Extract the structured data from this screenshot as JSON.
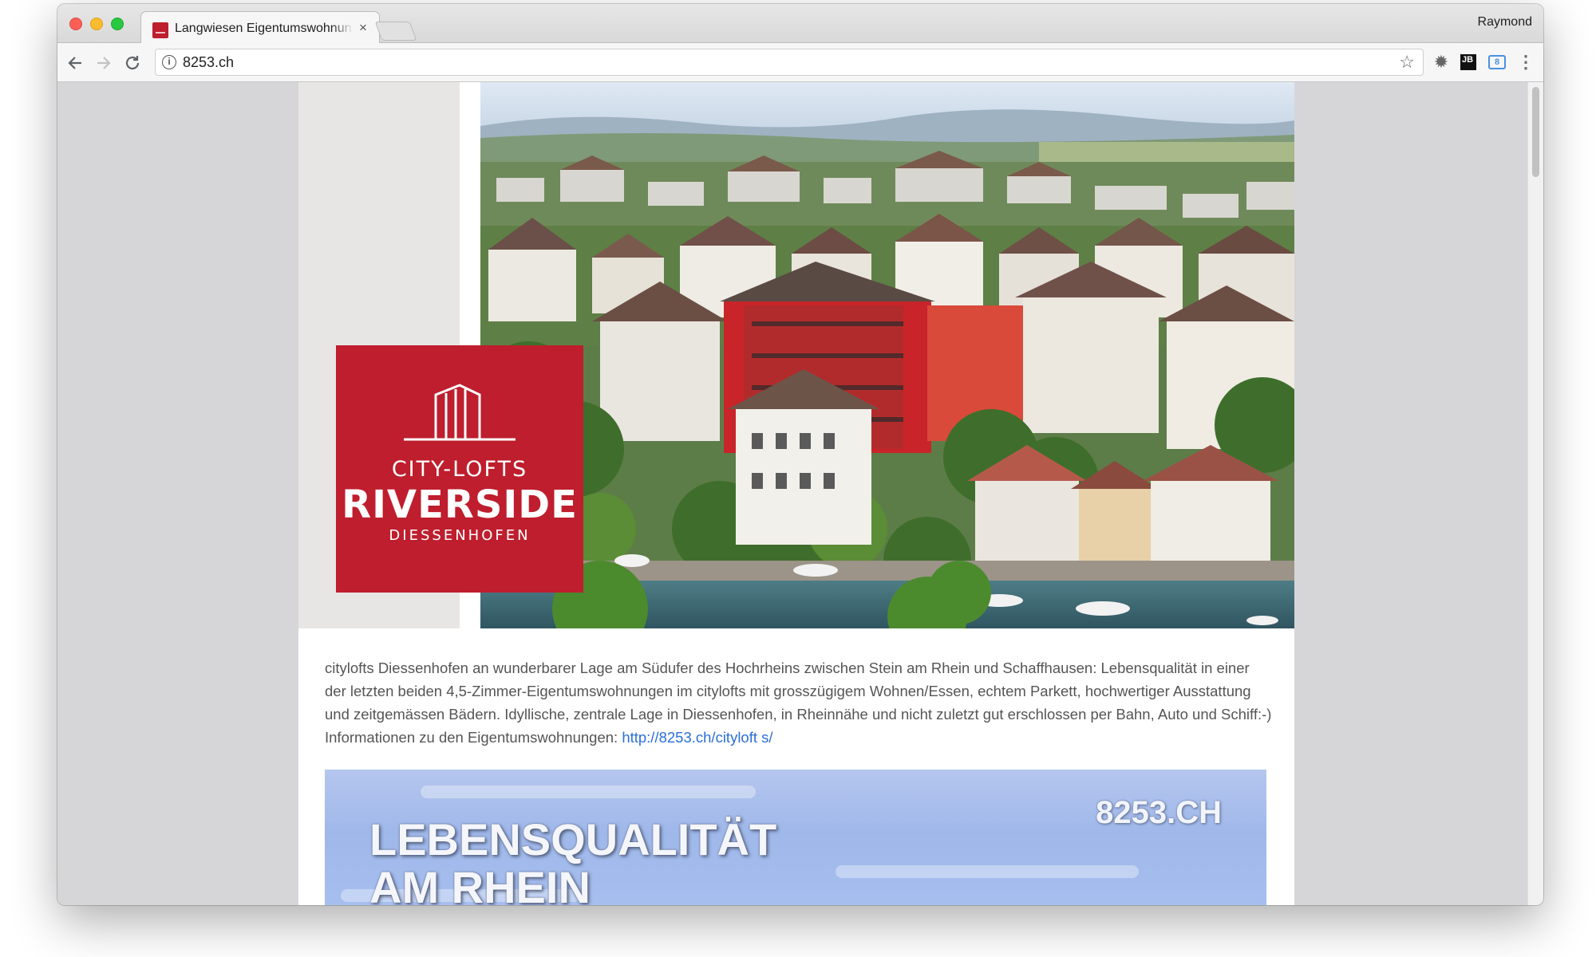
{
  "browser": {
    "tab_title": "Langwiesen Eigentumswohnungen",
    "tab_close": "×",
    "profile_name": "Raymond",
    "url": "8253.ch",
    "icons": {
      "back": "arrow-left",
      "forward": "arrow-right",
      "reload": "reload",
      "info": "i",
      "star": "☆",
      "gear": "✹",
      "jb": "JB",
      "ext_blue": "8",
      "menu": "⋮"
    }
  },
  "logo": {
    "line1": "CITY-LOFTS",
    "line2": "RIVERSIDE",
    "line3": "DIESSENHOFEN",
    "color": "#be1e2d"
  },
  "intro": {
    "text": "citylofts Diessenhofen an wunderbarer Lage am Südufer des Hochrheins zwischen Stein am Rhein und Schaffhausen: Lebensqualität in einer der letzten beiden 4,5-Zimmer-Eigentumswohnungen im citylofts mit grosszügigem Wohnen/Essen, echtem Parkett, hochwertiger Ausstattung und zeitgemässen Bädern. Idyllische, zentrale Lage in Diessenhofen, in Rheinnähe und nicht zuletzt gut erschlossen per Bahn, Auto und Schiff:-) Informationen zu den Eigentumswohnungen: ",
    "link_text": "http://8253.ch/cityloft s/",
    "link_color": "#2a6fd6"
  },
  "banner": {
    "brand": "8253.CH",
    "title_line1": "LEBENSQUALITÄT",
    "title_line2": "AM RHEIN"
  }
}
